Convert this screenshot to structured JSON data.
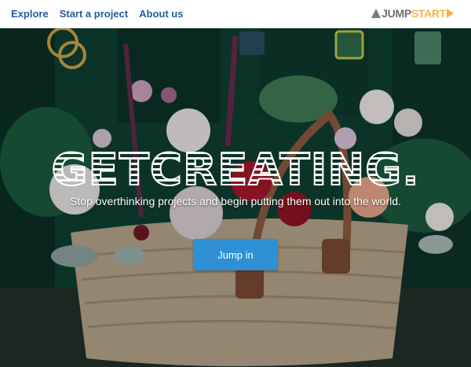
{
  "nav": {
    "links": [
      {
        "label": "Explore"
      },
      {
        "label": "Start a project"
      },
      {
        "label": "About us"
      }
    ],
    "logo": {
      "part1": "JUMP",
      "part2": "START"
    }
  },
  "hero": {
    "headline": "GETCREATING.",
    "subtitle": "Stop overthinking projects and begin putting them out into the world.",
    "cta_label": "Jump in"
  },
  "colors": {
    "nav_link": "#1f5c9f",
    "logo_gray": "#6f6f6f",
    "logo_orange": "#f4b44a",
    "cta_blue": "#2f90d6",
    "hero_green": "#114737"
  }
}
